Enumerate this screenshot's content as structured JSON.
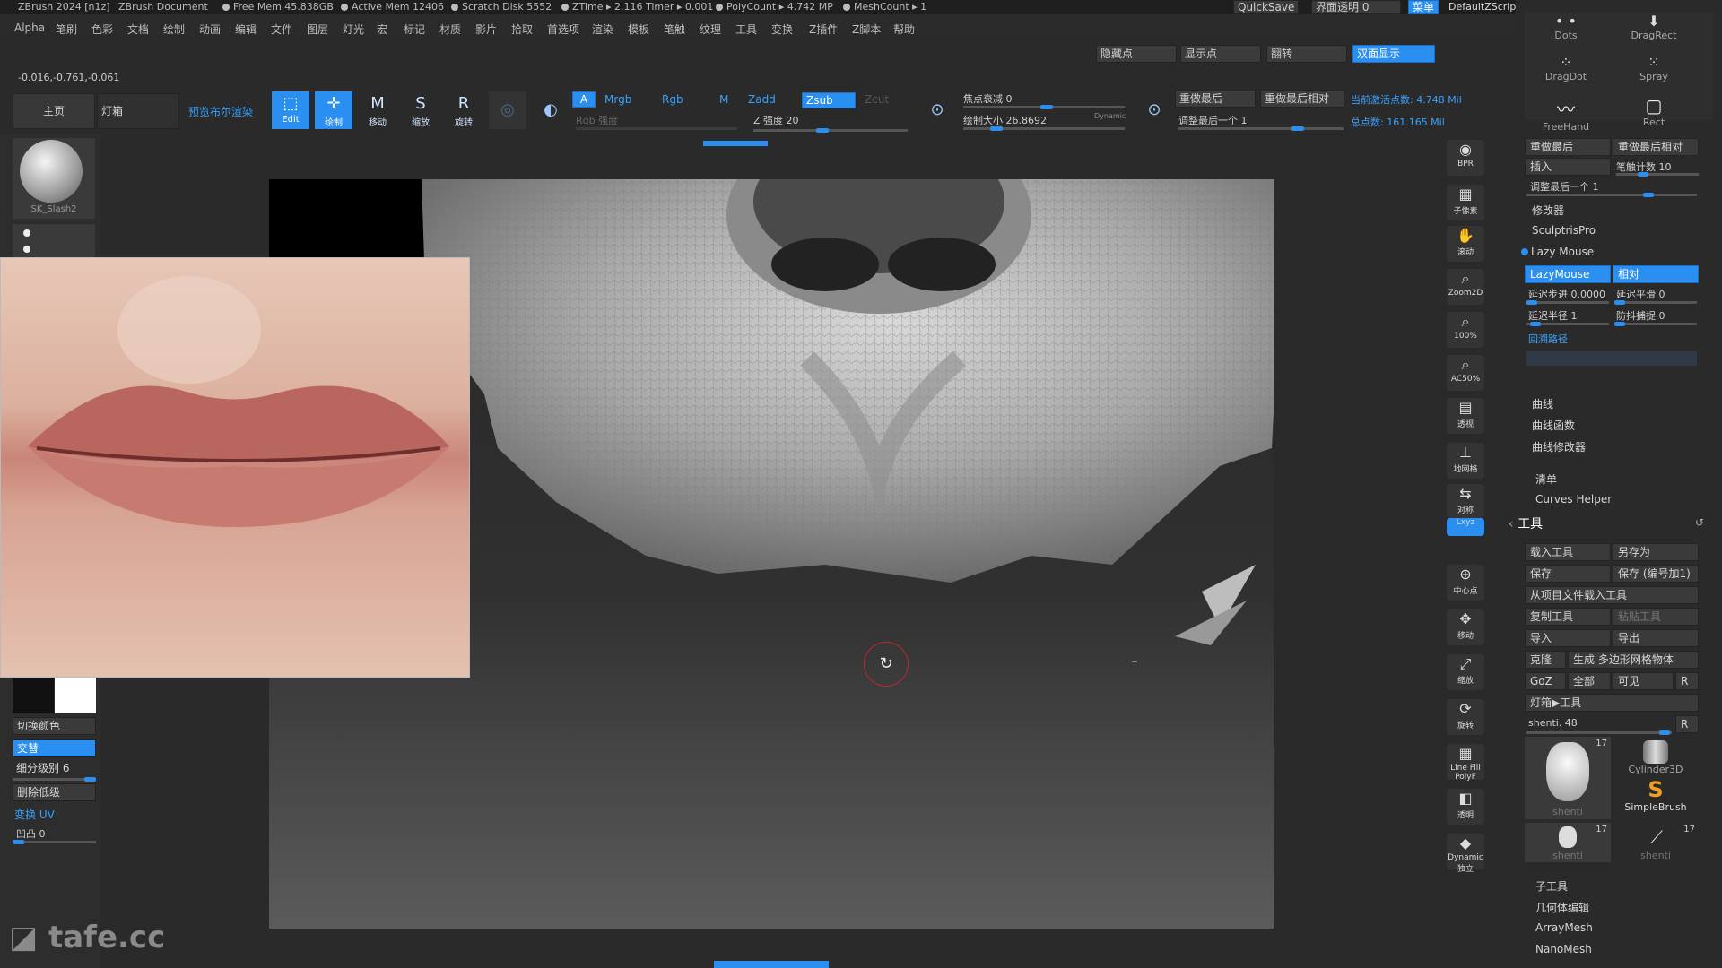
{
  "titlebar": {
    "app": "ZBrush 2024 [n1z]",
    "doc": "ZBrush Document",
    "free_mem": "Free Mem 45.838GB",
    "active_mem": "Active Mem 12406",
    "scratch": "Scratch Disk 5552",
    "ztime": "ZTime ▸ 2.116 Timer ▸ 0.001",
    "polycount": "PolyCount ▸ 4.742 MP",
    "meshcount": "MeshCount ▸ 1",
    "quicksave": "QuickSave",
    "transparency": "界面透明 0",
    "menu": "菜单",
    "zscript": "DefaultZScript"
  },
  "menubar": [
    "Alpha",
    "笔刷",
    "色彩",
    "文档",
    "绘制",
    "动画",
    "编辑",
    "文件",
    "图层",
    "灯光",
    "宏",
    "标记",
    "材质",
    "影片",
    "拾取",
    "首选项",
    "渲染",
    "模板",
    "笔触",
    "纹理",
    "工具",
    "变换",
    "Z插件",
    "Z脚本",
    "帮助"
  ],
  "toolbar": {
    "coords": "-0.016,-0.761,-0.061",
    "home_tab": "主页",
    "lightbox_tab": "灯箱",
    "preview_render": "预览布尔渲染",
    "hide_points": "隐藏点",
    "show_points": "显示点",
    "flip": "翻转",
    "double_sided": "双面显示",
    "icons": {
      "edit": "Edit",
      "draw": "绘制",
      "move": "移动",
      "scale": "缩放",
      "rotate": "旋转"
    },
    "a_label": "A",
    "mrgb": "Mrgb",
    "rgb": "Rgb",
    "m": "M",
    "zadd": "Zadd",
    "zsub": "Zsub",
    "zcut": "Zcut",
    "rgb_intensity": "Rgb 强度",
    "z_intensity": "Z 强度 20",
    "z_intensity_value": 20,
    "focal_shift": "焦点衰减 0",
    "draw_size": "绘制大小 26.8692",
    "dynamic": "Dynamic",
    "redo_last": "重做最后",
    "redo_last_rel": "重做最后相对",
    "adjust_last": "调整最后一个 1",
    "active_points": "当前激活点数: 4.748 Mil",
    "total_points": "总点数: 161.165 Mil"
  },
  "left_panel": {
    "brush_name": "SK_Slash2",
    "switch_color": "切换颜色",
    "alternate": "交替",
    "subdiv_level": "细分级别 6",
    "delete_lower": "删除低级",
    "transform_uv": "变换 UV",
    "bump": "凹凸 0"
  },
  "right_strip": [
    "BPR",
    "子像素",
    "滚动",
    "Zoom2D",
    "100%",
    "AC50%",
    "透视",
    "地网格",
    "对称",
    "Lxyz",
    "中心点",
    "移动",
    "缩放",
    "旋转",
    "Line Fill PolyF",
    "透明",
    "Dynamic 独立"
  ],
  "right_panel": {
    "brushes": [
      "Dots",
      "DragRect",
      "DragDot",
      "Spray",
      "FreeHand",
      "Rect"
    ],
    "redo_last": "重做最后",
    "redo_last_rel": "重做最后相对",
    "insert": "插入",
    "stroke_count": "笔触计数 10",
    "adjust_last": "调整最后一个 1",
    "modifiers": "修改器",
    "sculptris": "SculptrisPro",
    "lazy_mouse_section": "Lazy Mouse",
    "lazy_mouse_btn": "LazyMouse",
    "relative_btn": "相对",
    "lazy_step": "延迟步进 0.0000",
    "lazy_smooth": "延迟平滑 0",
    "lazy_radius": "延迟半径 1",
    "backtrack": "防抖捕捉 0",
    "backtrack_path": "回溯路径",
    "curve": "曲线",
    "curve_functions": "曲线函数",
    "curve_modifiers": "曲线修改器",
    "list": "清单",
    "curves_helper": "Curves Helper",
    "tool_title": "工具",
    "load_tool": "载入工具",
    "save_as": "另存为",
    "save": "保存",
    "save_inc": "保存 (编号加1)",
    "load_from_project": "从项目文件载入工具",
    "copy_tool": "复制工具",
    "paste_tool": "粘贴工具",
    "import": "导入",
    "export": "导出",
    "clone": "克隆",
    "make_polymesh": "生成 多边形网格物体",
    "goz": "GoZ",
    "all": "全部",
    "visible": "可见",
    "r": "R",
    "lightbox_tool": "灯箱▶工具",
    "shenti": "shenti. 48",
    "tool_thumbs": [
      "shenti",
      "Cylinder3D",
      "SimpleBrush",
      "shenti",
      "shenti"
    ],
    "thumb_count": "17",
    "subtool": "子工具",
    "geometry": "几何体编辑",
    "arraymesh": "ArrayMesh",
    "nanomesh": "NanoMesh"
  },
  "watermark": "tafe.cc"
}
